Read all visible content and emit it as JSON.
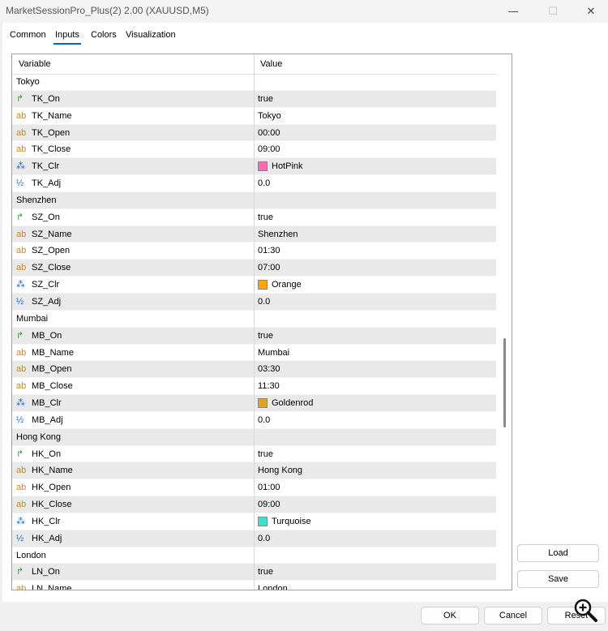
{
  "window": {
    "title": "MarketSessionPro_Plus(2) 2.00 (XAUUSD,M5)",
    "minimize_glyph": "—",
    "maximize_glyph": "☐",
    "close_glyph": "✕"
  },
  "tabs": [
    {
      "label": "Common"
    },
    {
      "label": "Inputs"
    },
    {
      "label": "Colors"
    },
    {
      "label": "Visualization"
    }
  ],
  "grid": {
    "col_variable": "Variable",
    "col_value": "Value",
    "rows": [
      {
        "kind": "group",
        "name": "Tokyo",
        "value": ""
      },
      {
        "kind": "bool",
        "name": "TK_On",
        "value": "true"
      },
      {
        "kind": "string",
        "name": "TK_Name",
        "value": "Tokyo"
      },
      {
        "kind": "string",
        "name": "TK_Open",
        "value": "00:00"
      },
      {
        "kind": "string",
        "name": "TK_Close",
        "value": "09:00"
      },
      {
        "kind": "color",
        "name": "TK_Clr",
        "value": "HotPink",
        "color": "#ff69b4"
      },
      {
        "kind": "number",
        "name": "TK_Adj",
        "value": "0.0"
      },
      {
        "kind": "group",
        "name": "Shenzhen",
        "value": ""
      },
      {
        "kind": "bool",
        "name": "SZ_On",
        "value": "true"
      },
      {
        "kind": "string",
        "name": "SZ_Name",
        "value": "Shenzhen"
      },
      {
        "kind": "string",
        "name": "SZ_Open",
        "value": "01:30"
      },
      {
        "kind": "string",
        "name": "SZ_Close",
        "value": "07:00"
      },
      {
        "kind": "color",
        "name": "SZ_Clr",
        "value": "Orange",
        "color": "#ffa500"
      },
      {
        "kind": "number",
        "name": "SZ_Adj",
        "value": "0.0"
      },
      {
        "kind": "group",
        "name": "Mumbai",
        "value": ""
      },
      {
        "kind": "bool",
        "name": "MB_On",
        "value": "true"
      },
      {
        "kind": "string",
        "name": "MB_Name",
        "value": "Mumbai"
      },
      {
        "kind": "string",
        "name": "MB_Open",
        "value": "03:30"
      },
      {
        "kind": "string",
        "name": "MB_Close",
        "value": "11:30"
      },
      {
        "kind": "color",
        "name": "MB_Clr",
        "value": "Goldenrod",
        "color": "#daa520"
      },
      {
        "kind": "number",
        "name": "MB_Adj",
        "value": "0.0"
      },
      {
        "kind": "group",
        "name": "Hong Kong",
        "value": ""
      },
      {
        "kind": "bool",
        "name": "HK_On",
        "value": "true"
      },
      {
        "kind": "string",
        "name": "HK_Name",
        "value": "Hong Kong"
      },
      {
        "kind": "string",
        "name": "HK_Open",
        "value": "01:00"
      },
      {
        "kind": "string",
        "name": "HK_Close",
        "value": "09:00"
      },
      {
        "kind": "color",
        "name": "HK_Clr",
        "value": "Turquoise",
        "color": "#40e0d0"
      },
      {
        "kind": "number",
        "name": "HK_Adj",
        "value": "0.0"
      },
      {
        "kind": "group",
        "name": "London",
        "value": ""
      },
      {
        "kind": "bool",
        "name": "LN_On",
        "value": "true"
      },
      {
        "kind": "string",
        "name": "LN_Name",
        "value": "London"
      }
    ]
  },
  "icons": {
    "bool": {
      "name": "bool-arrow-icon",
      "glyph": "↱",
      "color": "#2e9e3e"
    },
    "string": {
      "name": "string-ab-icon",
      "glyph": "ab",
      "color": "#c88a1a"
    },
    "color": {
      "name": "color-palette-icon",
      "glyph": "⁂",
      "color": "#2266cc"
    },
    "number": {
      "name": "number-half-icon",
      "glyph": "½",
      "color": "#2266cc"
    }
  },
  "buttons": {
    "load": "Load",
    "save": "Save",
    "ok": "OK",
    "cancel": "Cancel",
    "reset": "Reset"
  }
}
